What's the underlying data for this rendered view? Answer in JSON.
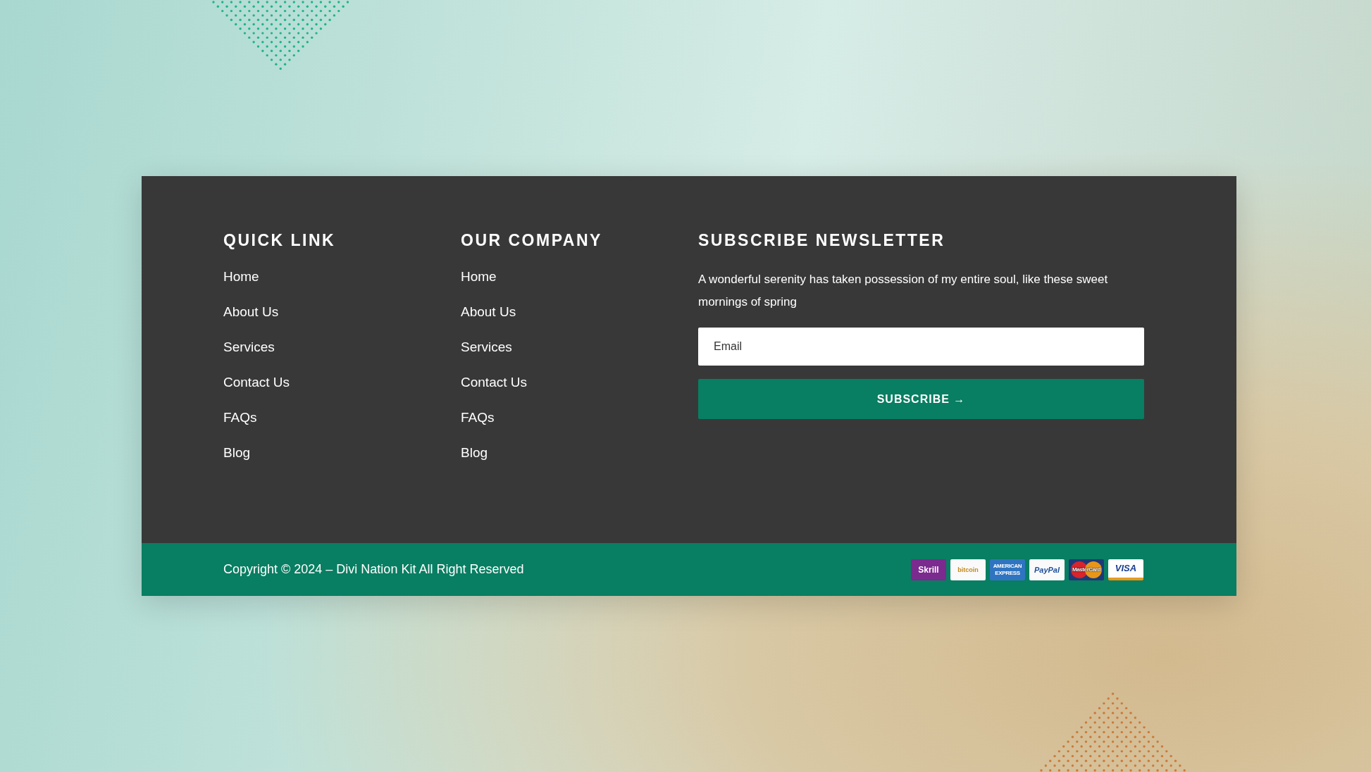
{
  "columns": [
    {
      "title": "QUICK LINK",
      "links": [
        "Home",
        "About Us",
        "Services",
        "Contact Us",
        "FAQs",
        "Blog"
      ]
    },
    {
      "title": "OUR COMPANY",
      "links": [
        "Home",
        "About Us",
        "Services",
        "Contact Us",
        "FAQs",
        "Blog"
      ]
    }
  ],
  "newsletter": {
    "title": "SUBSCRIBE NEWSLETTER",
    "text": "A wonderful serenity has taken possession of my entire soul, like these sweet mornings of spring",
    "email": {
      "placeholder": "Email"
    },
    "button": "SUBSCRIBE →"
  },
  "bottom_bar": {
    "copyright": "Copyright © 2024 – Divi Nation Kit All Right Reserved",
    "payment_methods": [
      {
        "kind": "skrill",
        "label": "Skrill"
      },
      {
        "kind": "bitcoin",
        "label": "bitcoin"
      },
      {
        "kind": "amex",
        "label": "AMERICAN EXPRESS"
      },
      {
        "kind": "paypal",
        "label": "PayPal"
      },
      {
        "kind": "mastercard",
        "label": "MasterCard"
      },
      {
        "kind": "visa",
        "label": "VISA"
      }
    ]
  }
}
